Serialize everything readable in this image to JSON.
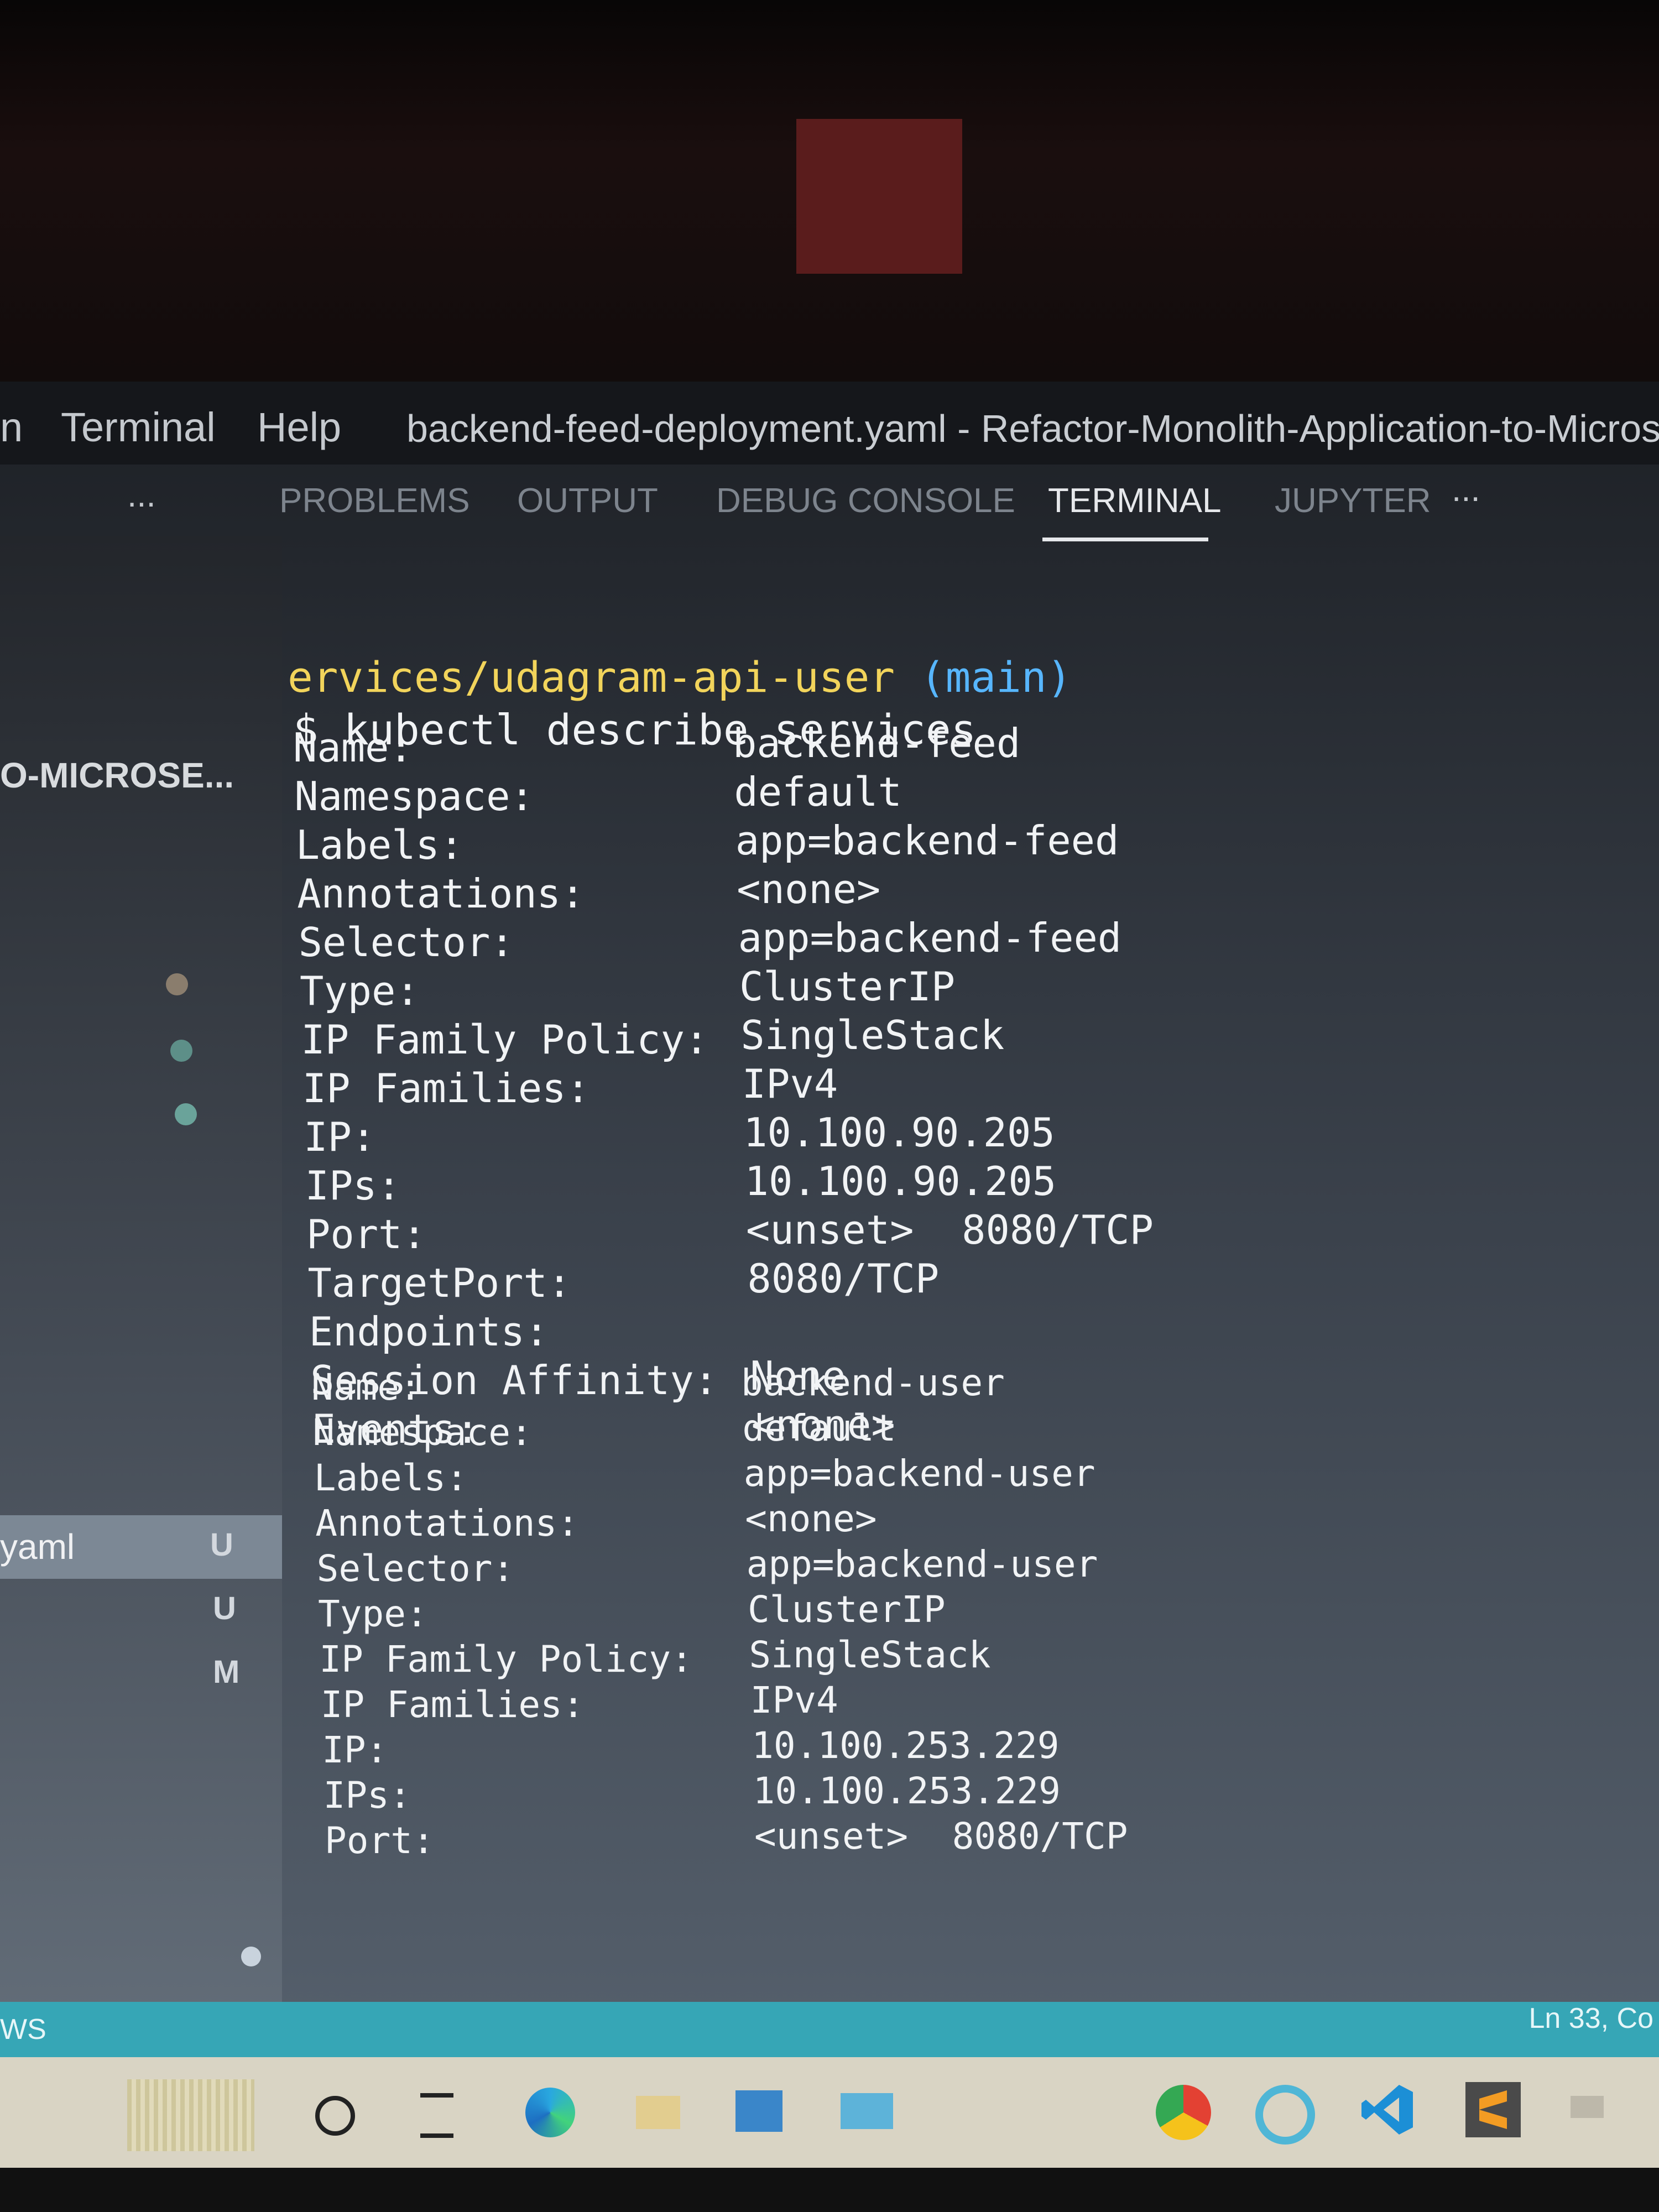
{
  "menubar": {
    "partial_left": "n",
    "terminal": "Terminal",
    "help": "Help",
    "window_title": "backend-feed-deployment.yaml - Refactor-Monolith-Application-to-Microserv"
  },
  "panel": {
    "more_left": "...",
    "tabs": [
      "PROBLEMS",
      "OUTPUT",
      "DEBUG CONSOLE",
      "TERMINAL",
      "JUPYTER"
    ],
    "active_tab": "TERMINAL",
    "more_right": "..."
  },
  "sidebar": {
    "heading": "O-MICROSE...",
    "file_label": "yaml",
    "badges": [
      "U",
      "U",
      "M"
    ],
    "dot_colors": [
      "#8a7d6d",
      "#5d8f88",
      "#6aa39a",
      "#c9d3dd",
      "#c9d3dd"
    ]
  },
  "terminal": {
    "cwd": "ervices/udagram-api-user",
    "branch": "(main)",
    "command": "$ kubectl describe services",
    "services": [
      {
        "fields": [
          {
            "key": "Name:",
            "value": "backend-feed"
          },
          {
            "key": "Namespace:",
            "value": "default"
          },
          {
            "key": "Labels:",
            "value": "app=backend-feed"
          },
          {
            "key": "Annotations:",
            "value": "<none>"
          },
          {
            "key": "Selector:",
            "value": "app=backend-feed"
          },
          {
            "key": "Type:",
            "value": "ClusterIP"
          },
          {
            "key": "IP Family Policy:",
            "value": "SingleStack"
          },
          {
            "key": "IP Families:",
            "value": "IPv4"
          },
          {
            "key": "IP:",
            "value": "10.100.90.205"
          },
          {
            "key": "IPs:",
            "value": "10.100.90.205"
          },
          {
            "key": "Port:",
            "value": "<unset>  8080/TCP"
          },
          {
            "key": "TargetPort:",
            "value": "8080/TCP"
          },
          {
            "key": "Endpoints:",
            "value": ""
          },
          {
            "key": "Session Affinity:",
            "value": "None"
          },
          {
            "key": "Events:",
            "value": "<none>"
          }
        ]
      },
      {
        "fields": [
          {
            "key": "Name:",
            "value": "backend-user"
          },
          {
            "key": "Namespace:",
            "value": "default"
          },
          {
            "key": "Labels:",
            "value": "app=backend-user"
          },
          {
            "key": "Annotations:",
            "value": "<none>"
          },
          {
            "key": "Selector:",
            "value": "app=backend-user"
          },
          {
            "key": "Type:",
            "value": "ClusterIP"
          },
          {
            "key": "IP Family Policy:",
            "value": "SingleStack"
          },
          {
            "key": "IP Families:",
            "value": "IPv4"
          },
          {
            "key": "IP:",
            "value": "10.100.253.229"
          },
          {
            "key": "IPs:",
            "value": "10.100.253.229"
          },
          {
            "key": "Port:",
            "value": "<unset>  8080/TCP"
          }
        ]
      }
    ]
  },
  "statusbar": {
    "left": "WS",
    "right": "Ln 33, Co"
  },
  "taskbar": {
    "icons": [
      "widgets-icon",
      "search-circle-icon",
      "task-view-icon",
      "edge-icon",
      "file-explorer-icon",
      "store-icon",
      "mail-icon",
      "chrome-icon",
      "refresh-app-icon",
      "vscode-icon",
      "sublime-icon",
      "overflow-icon"
    ]
  }
}
